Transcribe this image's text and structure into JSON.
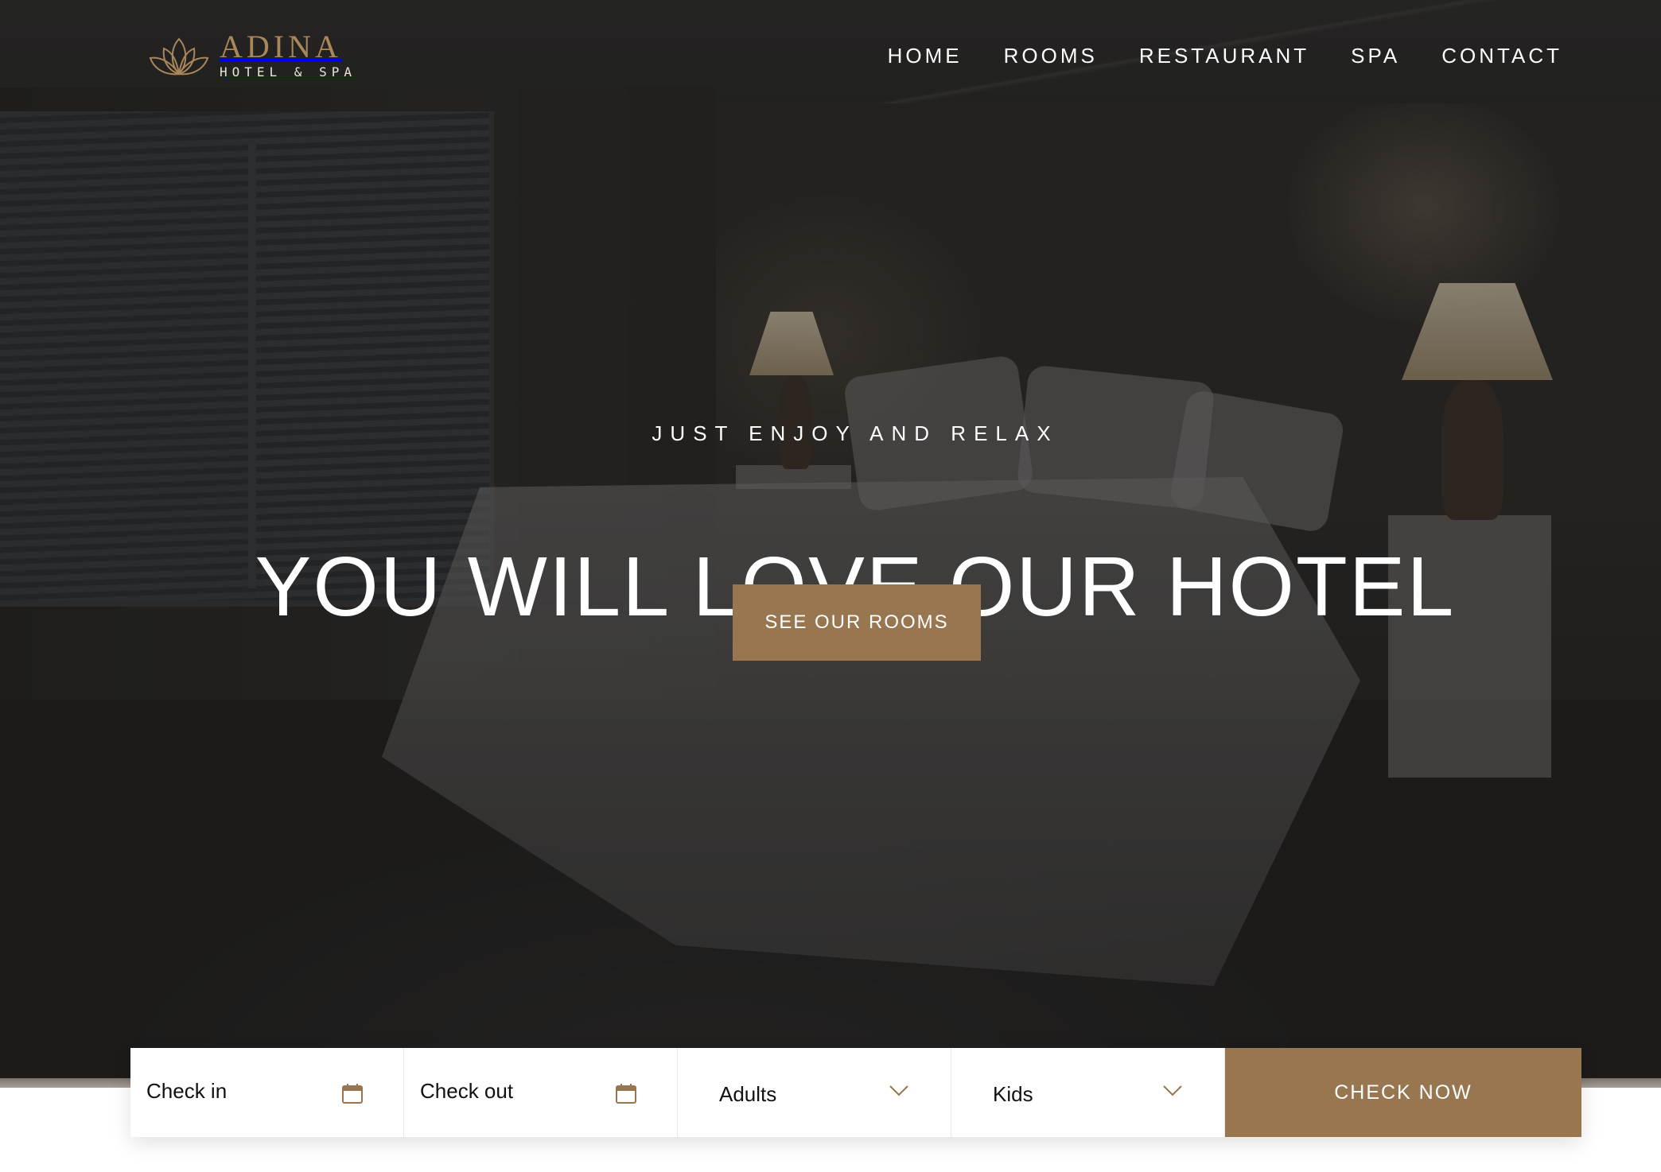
{
  "brand": {
    "name": "ADINA",
    "subtitle": "HOTEL & SPA",
    "logo_icon": "lotus-icon",
    "accent_color": "#977650"
  },
  "nav": {
    "items": [
      {
        "label": "HOME"
      },
      {
        "label": "ROOMS"
      },
      {
        "label": "RESTAURANT"
      },
      {
        "label": "SPA"
      },
      {
        "label": "CONTACT"
      }
    ]
  },
  "hero": {
    "tagline": "JUST ENJOY AND RELAX",
    "headline": "YOU WILL LOVE OUR HOTEL",
    "cta_label": "SEE OUR ROOMS"
  },
  "booking": {
    "check_in": {
      "label": "Check in",
      "icon": "calendar-icon"
    },
    "check_out": {
      "label": "Check out",
      "icon": "calendar-icon"
    },
    "adults": {
      "label": "Adults",
      "icon": "chevron-down-icon"
    },
    "kids": {
      "label": "Kids",
      "icon": "chevron-down-icon"
    },
    "submit_label": "CHECK NOW"
  }
}
